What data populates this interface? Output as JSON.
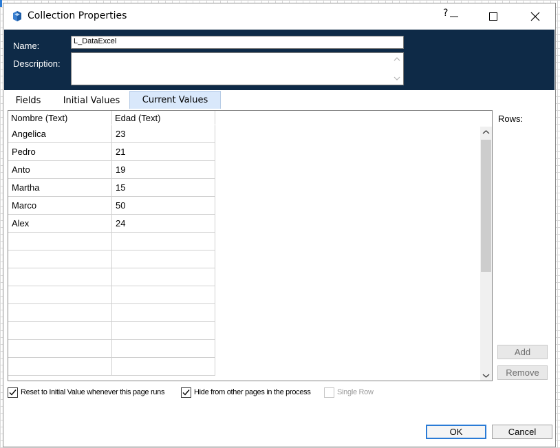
{
  "window": {
    "title": "Collection Properties",
    "help_label": "?",
    "icons": {
      "app": "collection-icon",
      "maximize": "maximize-icon",
      "close": "close-icon"
    }
  },
  "header": {
    "name_label": "Name:",
    "name_value": "L_DataExcel",
    "description_label": "Description:",
    "description_value": ""
  },
  "tabs": [
    {
      "label": "Fields",
      "active": false
    },
    {
      "label": "Initial Values",
      "active": false
    },
    {
      "label": "Current Values",
      "active": true
    }
  ],
  "grid": {
    "columns": [
      "Nombre  (Text)",
      "Edad  (Text)"
    ],
    "rows": [
      [
        "Angelica",
        "23"
      ],
      [
        "Pedro",
        "21"
      ],
      [
        "Anto",
        "19"
      ],
      [
        "Martha",
        "15"
      ],
      [
        "Marco",
        "50"
      ],
      [
        "Alex",
        "24"
      ]
    ],
    "empty_rows": 8
  },
  "side": {
    "rows_label": "Rows:",
    "add_label": "Add",
    "remove_label": "Remove"
  },
  "options": {
    "reset_label": "Reset to Initial Value whenever this page runs",
    "reset_checked": true,
    "hide_label": "Hide from other pages in the process",
    "hide_checked": true,
    "single_row_label": "Single Row",
    "single_row_checked": false,
    "single_row_enabled": false
  },
  "footer": {
    "ok_label": "OK",
    "cancel_label": "Cancel"
  },
  "colors": {
    "header_bg": "#0e2a47",
    "active_tab_bg": "#d9e8fb",
    "ok_border": "#2a7bd6"
  }
}
